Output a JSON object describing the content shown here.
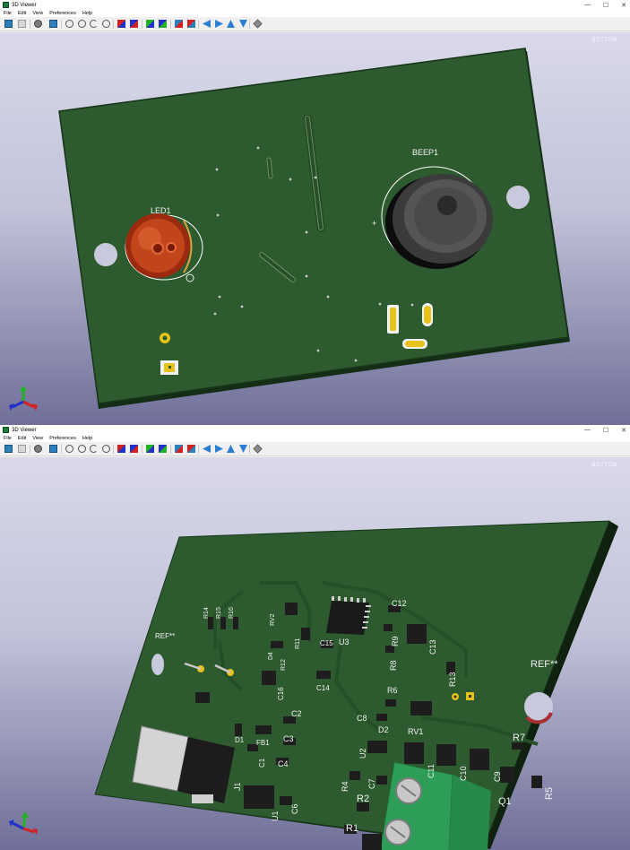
{
  "windows": [
    {
      "title": "3D Viewer",
      "menus": [
        "File",
        "Edit",
        "View",
        "Preferences",
        "Help"
      ],
      "corner_label": "BOTTOM",
      "board_side": "bottom",
      "labels": {
        "led": "LED1",
        "beep": "BEEP1"
      }
    },
    {
      "title": "3D Viewer",
      "menus": [
        "File",
        "Edit",
        "View",
        "Preferences",
        "Help"
      ],
      "corner_label": "BOTTOM",
      "board_side": "top",
      "labels": {
        "r14": "R14",
        "r15": "R15",
        "r16": "R16",
        "rv2": "RV2",
        "c12": "C12",
        "r9": "R9",
        "c13": "C13",
        "r11": "R11",
        "u3": "U3",
        "c15": "C15",
        "d4": "D4",
        "r12": "R12",
        "r8": "R8",
        "c16": "C16",
        "c14": "C14",
        "ref1": "REF**",
        "ref2": "REF**",
        "r13": "R13",
        "r6": "R6",
        "rv1": "RV1",
        "c8": "C8",
        "d2": "D2",
        "c2": "C2",
        "d1": "D1",
        "fb1": "FB1",
        "c3": "C3",
        "c1": "C1",
        "c4": "C4",
        "u2": "U2",
        "c11": "C11",
        "c10": "C10",
        "c9": "C9",
        "r7": "R7",
        "q1": "Q1",
        "r5": "R5",
        "r4": "R4",
        "c7": "C7",
        "j1": "J1",
        "u1": "U1",
        "c6": "C6",
        "r2": "R2",
        "r1": "R1",
        "l1": "L1"
      }
    }
  ],
  "window_controls": {
    "minimize": "—",
    "maximize": "☐",
    "close": "✕"
  },
  "colors": {
    "pcb_green": "#2b5a2c",
    "pcb_edge": "#0f2a12",
    "silkscreen": "#f2f2f2",
    "pad_gold": "#e7c21c",
    "background_top": "#d9d9ea",
    "background_bottom": "#6f6f99"
  },
  "toolbar": [
    {
      "name": "render-raytracing-icon"
    },
    {
      "name": "copy-image-icon"
    },
    {
      "name": "settings-icon"
    },
    {
      "name": "3d-box-icon"
    },
    {
      "name": "zoom-in-icon"
    },
    {
      "name": "zoom-out-icon"
    },
    {
      "name": "redraw-icon"
    },
    {
      "name": "zoom-fit-icon"
    },
    {
      "name": "rotate-x-cw-icon"
    },
    {
      "name": "rotate-x-ccw-icon"
    },
    {
      "name": "rotate-y-cw-icon"
    },
    {
      "name": "rotate-y-ccw-icon"
    },
    {
      "name": "rotate-z-cw-icon"
    },
    {
      "name": "rotate-z-ccw-icon"
    },
    {
      "name": "pan-left-icon"
    },
    {
      "name": "pan-right-icon"
    },
    {
      "name": "pan-up-icon"
    },
    {
      "name": "pan-down-icon"
    },
    {
      "name": "orthographic-icon"
    }
  ]
}
